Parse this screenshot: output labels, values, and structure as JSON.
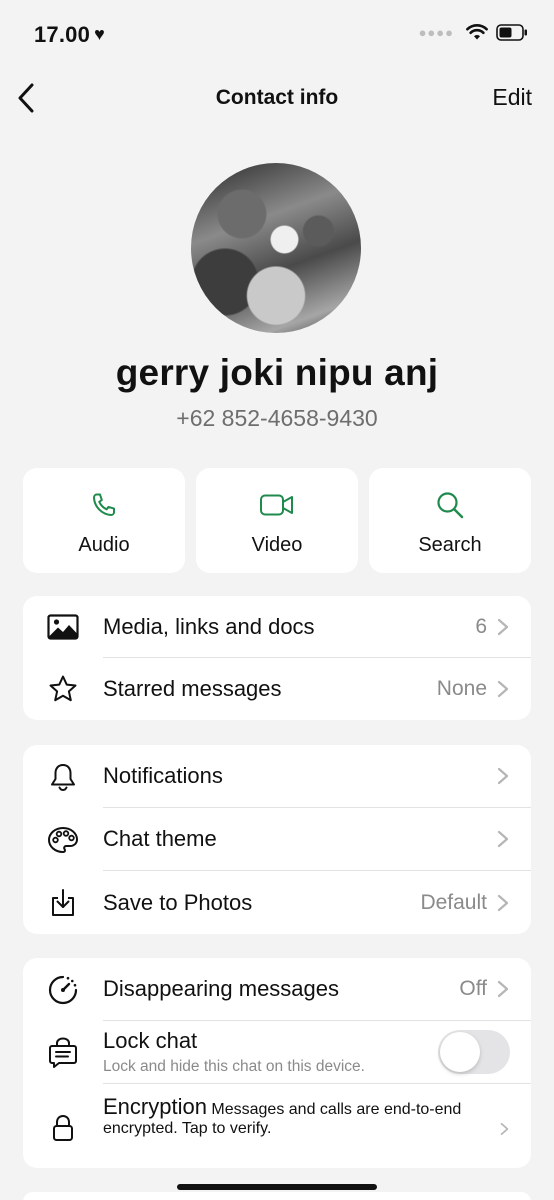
{
  "status_bar": {
    "time": "17.00"
  },
  "nav": {
    "back_label": "",
    "title": "Contact info",
    "edit_label": "Edit"
  },
  "contact": {
    "name": "gerry joki nipu anj",
    "phone": "+62 852-4658-9430"
  },
  "actions": [
    {
      "label": "Audio",
      "icon": "phone-icon"
    },
    {
      "label": "Video",
      "icon": "video-icon"
    },
    {
      "label": "Search",
      "icon": "search-icon"
    }
  ],
  "media_section": {
    "media": {
      "label": "Media, links and docs",
      "value": "6"
    },
    "starred": {
      "label": "Starred messages",
      "value": "None"
    }
  },
  "settings_section": {
    "notifications": {
      "label": "Notifications"
    },
    "chat_theme": {
      "label": "Chat theme"
    },
    "save_to_photos": {
      "label": "Save to Photos",
      "value": "Default"
    }
  },
  "privacy_section": {
    "disappearing": {
      "label": "Disappearing messages",
      "value": "Off"
    },
    "lock_chat": {
      "label": "Lock chat",
      "sub": "Lock and hide this chat on this device.",
      "enabled": false
    },
    "encryption": {
      "label": "Encryption",
      "sub": "Messages and calls are end-to-end encrypted. Tap to verify."
    }
  },
  "colors": {
    "accent": "#1f8a4c",
    "background": "#f3f3f3",
    "card": "#ffffff"
  }
}
